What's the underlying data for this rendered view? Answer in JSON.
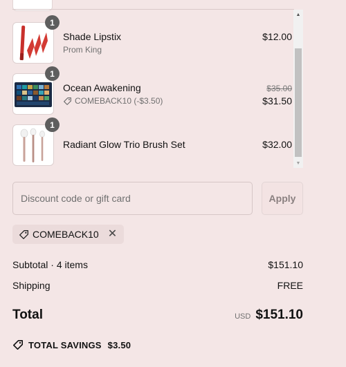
{
  "cart": {
    "items": [
      {
        "quantity": "1",
        "name": "Shade Lipstix",
        "subtitle": "Prom King",
        "price": "$12.00",
        "image_icon": "lipstick-icon"
      },
      {
        "quantity": "1",
        "name": "Ocean Awakening",
        "discount_note": "COMEBACK10 (-$3.50)",
        "original_price": "$35.00",
        "price": "$31.50",
        "image_icon": "eyeshadow-palette-icon"
      },
      {
        "quantity": "1",
        "name": "Radiant Glow Trio Brush Set",
        "price": "$32.00",
        "image_icon": "brush-set-icon"
      }
    ]
  },
  "discount": {
    "placeholder": "Discount code or gift card",
    "value": "",
    "apply_label": "Apply",
    "applied_code": "COMEBACK10"
  },
  "summary": {
    "subtotal_label": "Subtotal · 4 items",
    "subtotal_value": "$151.10",
    "shipping_label": "Shipping",
    "shipping_value": "FREE",
    "total_label": "Total",
    "currency": "USD",
    "total_value": "$151.10",
    "savings_label": "TOTAL SAVINGS",
    "savings_value": "$3.50"
  },
  "colors": {
    "background": "#f4e6e6",
    "badge": "#5e5e5e",
    "chip": "#ebdbdb"
  }
}
